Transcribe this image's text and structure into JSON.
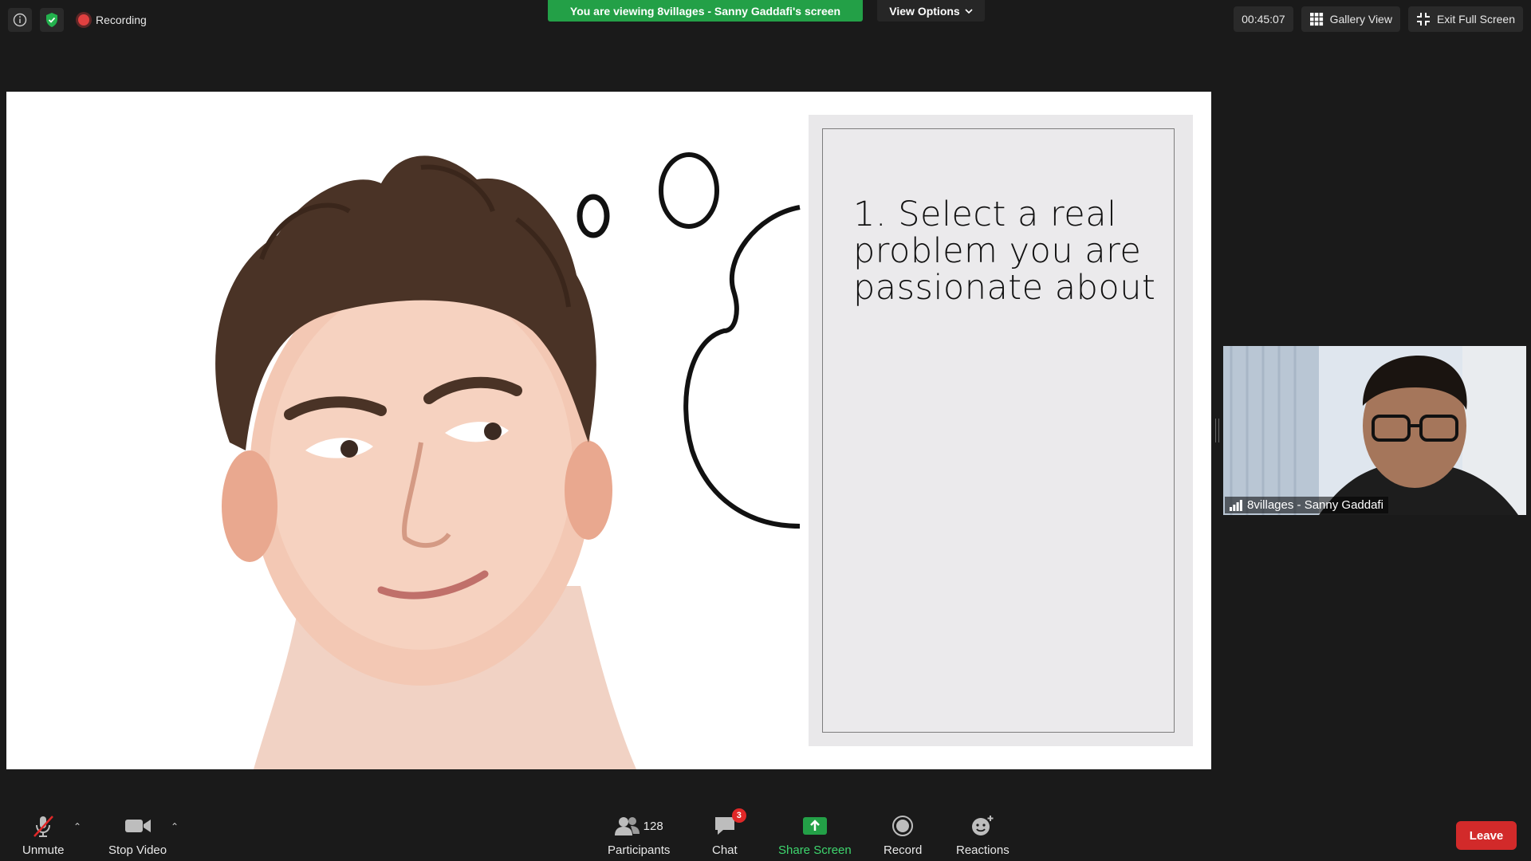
{
  "top_bar": {
    "recording_label": "Recording",
    "viewing_banner": "You are viewing 8villages - Sanny Gaddafi's screen",
    "view_options_label": "View Options",
    "timer": "00:45:07",
    "gallery_view_label": "Gallery View",
    "exit_fullscreen_label": "Exit Full Screen"
  },
  "slide": {
    "text": "1. Select a real problem you are passionate about"
  },
  "participant": {
    "name": "8villages - Sanny Gaddafi"
  },
  "toolbar": {
    "unmute_label": "Unmute",
    "stop_video_label": "Stop Video",
    "participants_label": "Participants",
    "participants_count": "128",
    "chat_label": "Chat",
    "chat_badge": "3",
    "share_screen_label": "Share Screen",
    "record_label": "Record",
    "reactions_label": "Reactions",
    "leave_label": "Leave"
  },
  "colors": {
    "banner_green": "#23a047",
    "leave_red": "#d22a2a",
    "share_green": "#3ed66e",
    "background": "#1a1a1a"
  }
}
